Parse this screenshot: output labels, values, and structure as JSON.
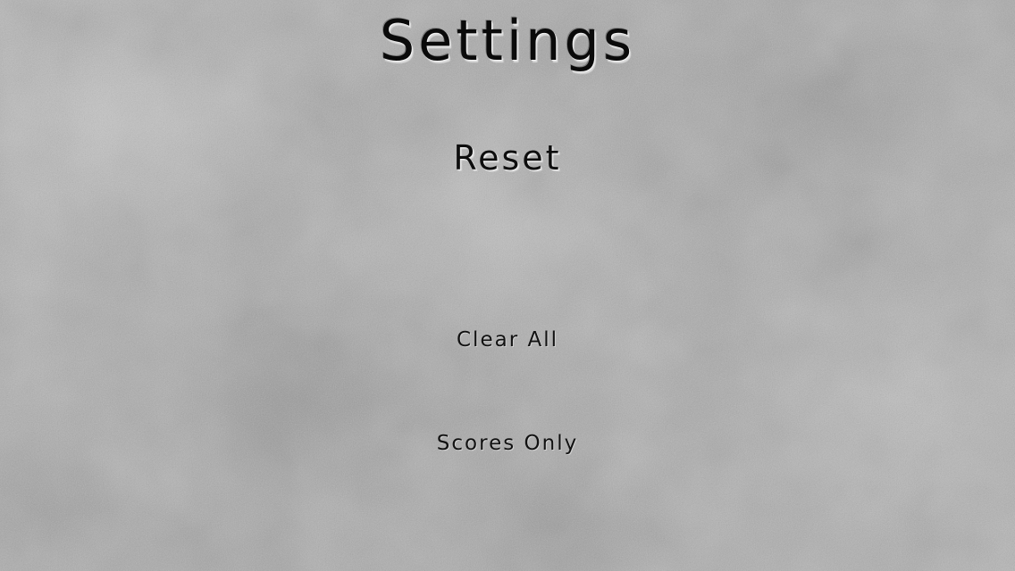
{
  "screen": {
    "title": "Settings"
  },
  "reset_section": {
    "heading": "Reset",
    "buttons": [
      {
        "label": "Clear All"
      },
      {
        "label": "Scores Only"
      }
    ]
  },
  "colors": {
    "background": "#a9a9a9",
    "text": "#0a0a0a",
    "text_highlight": "#f2f2f2"
  }
}
